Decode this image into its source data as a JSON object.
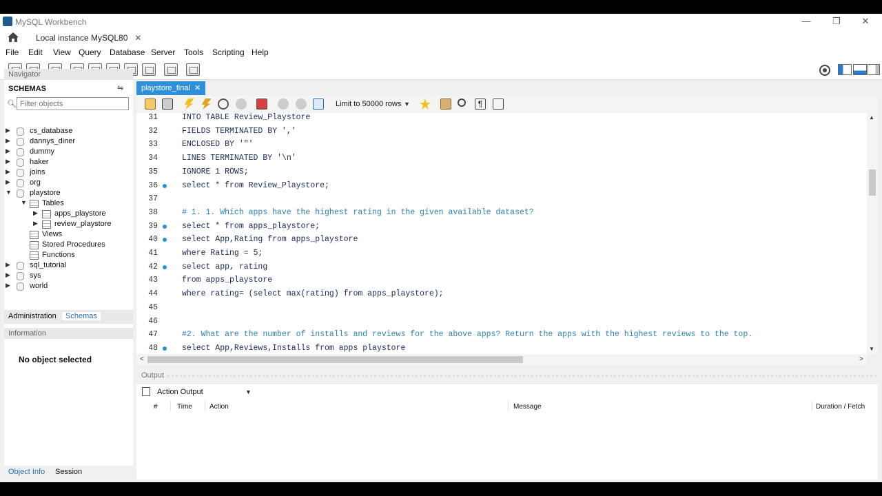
{
  "window": {
    "title": "MySQL Workbench",
    "connection_tab": "Local instance MySQL80",
    "controls": [
      "minimize-icon",
      "restore-icon",
      "close-icon"
    ]
  },
  "menu": [
    "File",
    "Edit",
    "View",
    "Query",
    "Database",
    "Server",
    "Tools",
    "Scripting",
    "Help"
  ],
  "navigator": {
    "header": "Navigator",
    "schemas_label": "SCHEMAS",
    "filter_placeholder": "Filter objects",
    "tree": [
      {
        "label": "cs_database",
        "expanded": false
      },
      {
        "label": "dannys_diner",
        "expanded": false
      },
      {
        "label": "dummy",
        "expanded": false
      },
      {
        "label": "haker",
        "expanded": false
      },
      {
        "label": "joins",
        "expanded": false
      },
      {
        "label": "org",
        "expanded": false
      },
      {
        "label": "playstore",
        "expanded": true
      },
      {
        "label": "Tables",
        "expanded": true
      },
      {
        "label": "apps_playstore",
        "expanded": false
      },
      {
        "label": "review_playstore",
        "expanded": false
      },
      {
        "label": "Views"
      },
      {
        "label": "Stored Procedures"
      },
      {
        "label": "Functions"
      },
      {
        "label": "sql_tutorial",
        "expanded": false
      },
      {
        "label": "sys",
        "expanded": false
      },
      {
        "label": "world",
        "expanded": false
      }
    ],
    "tabs": [
      "Administration",
      "Schemas"
    ],
    "info_header": "Information",
    "info_text": "No object selected",
    "bottom_tabs": [
      "Object Info",
      "Session"
    ]
  },
  "editor": {
    "tab": "playstore_final",
    "limit_label": "Limit to 50000 rows",
    "lines": [
      {
        "n": "31",
        "dot": false,
        "text": "INTO TABLE Review_Playstore"
      },
      {
        "n": "32",
        "dot": false,
        "text": "FIELDS TERMINATED BY ','"
      },
      {
        "n": "33",
        "dot": false,
        "text": "ENCLOSED BY '\"'"
      },
      {
        "n": "34",
        "dot": false,
        "text": "LINES TERMINATED BY '\\n'"
      },
      {
        "n": "35",
        "dot": false,
        "text": "IGNORE 1 ROWS;"
      },
      {
        "n": "36",
        "dot": true,
        "text": "select * from Review_Playstore;"
      },
      {
        "n": "37",
        "dot": false,
        "text": ""
      },
      {
        "n": "38",
        "dot": false,
        "text": "# 1. 1. Which apps have the highest rating in the given available dataset?",
        "comment": true
      },
      {
        "n": "39",
        "dot": true,
        "text": "select * from apps_playstore;"
      },
      {
        "n": "40",
        "dot": true,
        "text": "select App,Rating from apps_playstore"
      },
      {
        "n": "41",
        "dot": false,
        "text": "where Rating = 5;"
      },
      {
        "n": "42",
        "dot": true,
        "text": "select app, rating"
      },
      {
        "n": "43",
        "dot": false,
        "text": "from apps_playstore"
      },
      {
        "n": "44",
        "dot": false,
        "text": "where rating= (select max(rating) from apps_playstore);"
      },
      {
        "n": "45",
        "dot": false,
        "text": ""
      },
      {
        "n": "46",
        "dot": false,
        "text": ""
      },
      {
        "n": "47",
        "dot": false,
        "text": "#2. What are the number of installs and reviews for the above apps? Return the apps with the highest reviews to the top.",
        "comment": true
      },
      {
        "n": "48",
        "dot": true,
        "text": "select App,Reviews,Installs from apps playstore"
      }
    ]
  },
  "output": {
    "label": "Output",
    "selector": "Action Output",
    "columns": [
      "#",
      "Time",
      "Action",
      "Message",
      "Duration / Fetch"
    ]
  }
}
